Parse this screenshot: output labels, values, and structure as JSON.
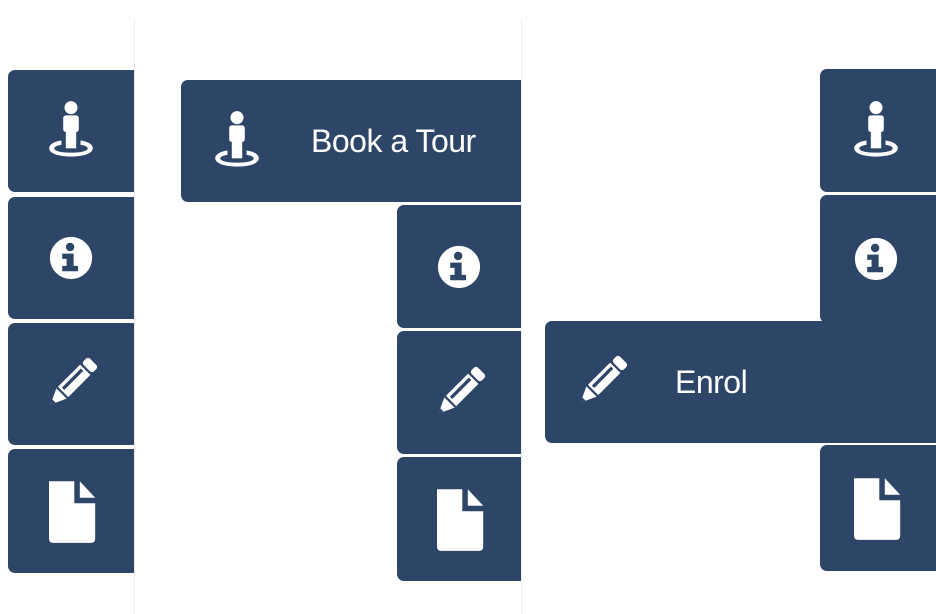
{
  "colors": {
    "tab_bg": "#2d4567",
    "icon": "#ffffff",
    "page_bg": "#ffffff"
  },
  "panels": [
    {
      "state": "collapsed",
      "items": [
        {
          "icon": "person-pin-icon"
        },
        {
          "icon": "info-icon"
        },
        {
          "icon": "pencil-icon"
        },
        {
          "icon": "file-icon"
        }
      ]
    },
    {
      "state": "tour-expanded",
      "items": [
        {
          "icon": "person-pin-icon",
          "label": "Book a Tour"
        },
        {
          "icon": "info-icon"
        },
        {
          "icon": "pencil-icon"
        },
        {
          "icon": "file-icon"
        }
      ]
    },
    {
      "state": "enrol-expanded",
      "items": [
        {
          "icon": "person-pin-icon"
        },
        {
          "icon": "info-icon"
        },
        {
          "icon": "pencil-icon",
          "label": "Enrol"
        },
        {
          "icon": "file-icon"
        }
      ]
    }
  ]
}
